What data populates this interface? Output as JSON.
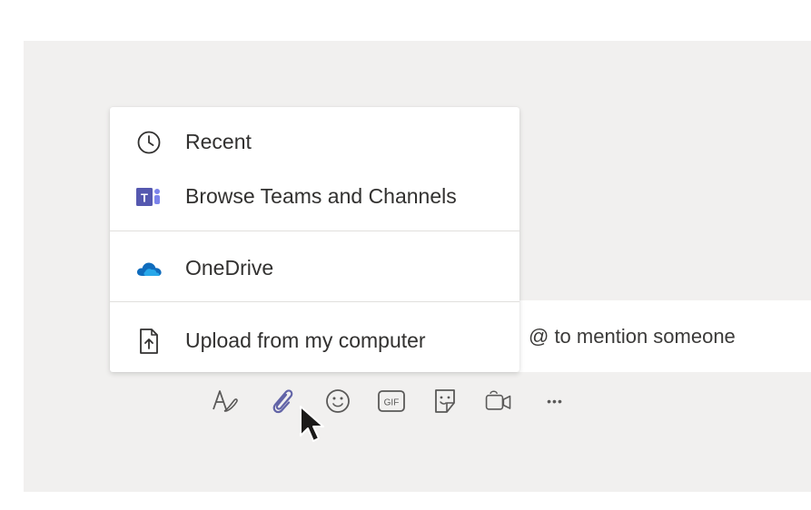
{
  "compose": {
    "placeholder_visible": "@ to mention someone"
  },
  "attach_menu": {
    "items": [
      {
        "label": "Recent",
        "icon": "clock-icon"
      },
      {
        "label": "Browse Teams and Channels",
        "icon": "teams-icon"
      },
      {
        "label": "OneDrive",
        "icon": "onedrive-icon"
      },
      {
        "label": "Upload from my computer",
        "icon": "upload-file-icon"
      }
    ]
  },
  "toolbar": {
    "icons": [
      "format-icon",
      "attach-icon",
      "emoji-icon",
      "gif-icon",
      "sticker-icon",
      "meet-now-icon",
      "more-options-icon"
    ],
    "gif_text": "GIF",
    "more_text": "•••"
  },
  "colors": {
    "accent": "#6264a7",
    "teams_purple": "#5558af",
    "onedrive_blue": "#0f6cbd",
    "panel_bg": "#f1f0ef"
  }
}
